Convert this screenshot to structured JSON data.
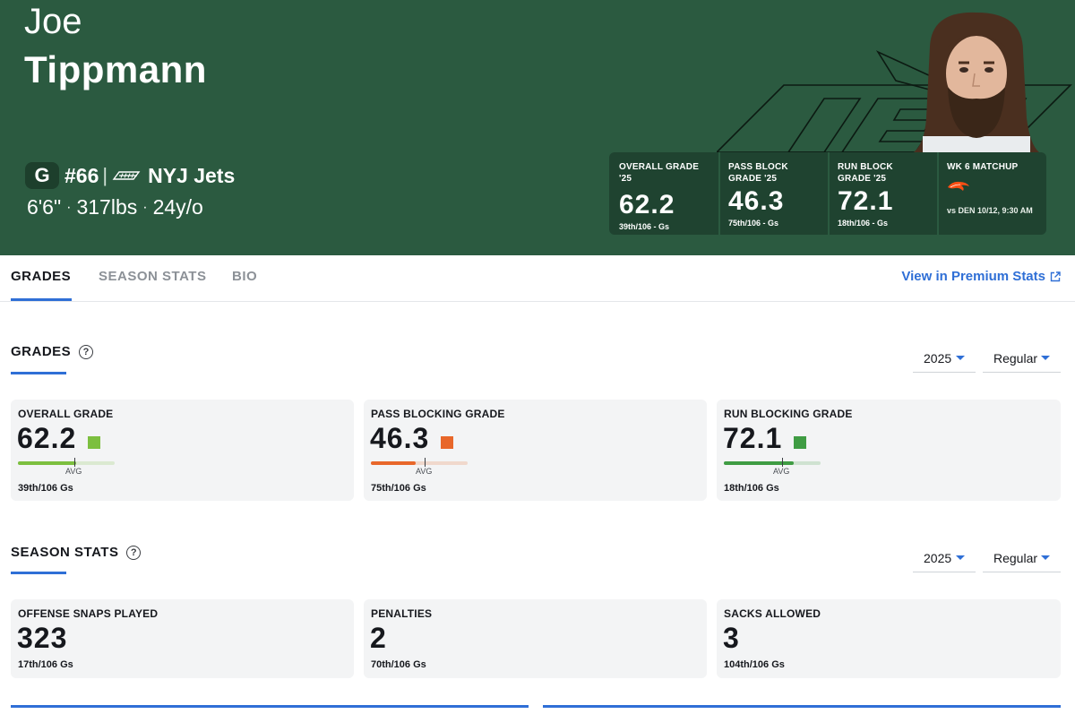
{
  "player": {
    "first_name": "Joe",
    "last_name": "Tippmann",
    "position": "G",
    "jersey": "#66",
    "separator": "|",
    "team_name": "NYJ Jets",
    "height": "6'6\"",
    "weight": "317lbs",
    "age": "24y/o",
    "dot": "·"
  },
  "hero_card": {
    "overall": {
      "label": "OVERALL GRADE '25",
      "value": "62.2",
      "rank": "39th/106 - Gs"
    },
    "pass_block": {
      "label": "PASS BLOCK GRADE '25",
      "value": "46.3",
      "rank": "75th/106 - Gs"
    },
    "run_block": {
      "label": "RUN BLOCK GRADE '25",
      "value": "72.1",
      "rank": "18th/106 - Gs"
    },
    "matchup": {
      "label": "WK 6 MATCHUP",
      "opponent_icon": "broncos-logo-icon",
      "text": "vs DEN 10/12, 9:30 AM"
    }
  },
  "tabs": [
    {
      "label": "GRADES",
      "active": true
    },
    {
      "label": "SEASON STATS",
      "active": false
    },
    {
      "label": "BIO",
      "active": false
    }
  ],
  "premium_link": {
    "label": "View in Premium Stats",
    "icon": "external-link-icon"
  },
  "grades_section": {
    "title": "GRADES",
    "help_icon": "?",
    "year": "2025",
    "season_type": "Regular",
    "avg_label": "AVG",
    "cards": [
      {
        "label": "OVERALL GRADE",
        "value": "62.2",
        "rank": "39th/106 Gs",
        "color": "#7cbf3f",
        "fill_fraction": 0.6,
        "avg_fraction": 0.58
      },
      {
        "label": "PASS BLOCKING GRADE",
        "value": "46.3",
        "rank": "75th/106 Gs",
        "color": "#e8672a",
        "fill_fraction": 0.46,
        "avg_fraction": 0.56
      },
      {
        "label": "RUN BLOCKING GRADE",
        "value": "72.1",
        "rank": "18th/106 Gs",
        "color": "#3f9c43",
        "fill_fraction": 0.72,
        "avg_fraction": 0.6
      }
    ]
  },
  "season_section": {
    "title": "SEASON STATS",
    "help_icon": "?",
    "year": "2025",
    "season_type": "Regular",
    "cards": [
      {
        "label": "OFFENSE SNAPS PLAYED",
        "value": "323",
        "rank": "17th/106 Gs"
      },
      {
        "label": "PENALTIES",
        "value": "2",
        "rank": "70th/106 Gs"
      },
      {
        "label": "SACKS ALLOWED",
        "value": "3",
        "rank": "104th/106 Gs"
      }
    ]
  },
  "colors": {
    "hero_bg": "#2b5a40",
    "hero_card_bg": "#1f4330",
    "accent": "#2f6fd6"
  }
}
